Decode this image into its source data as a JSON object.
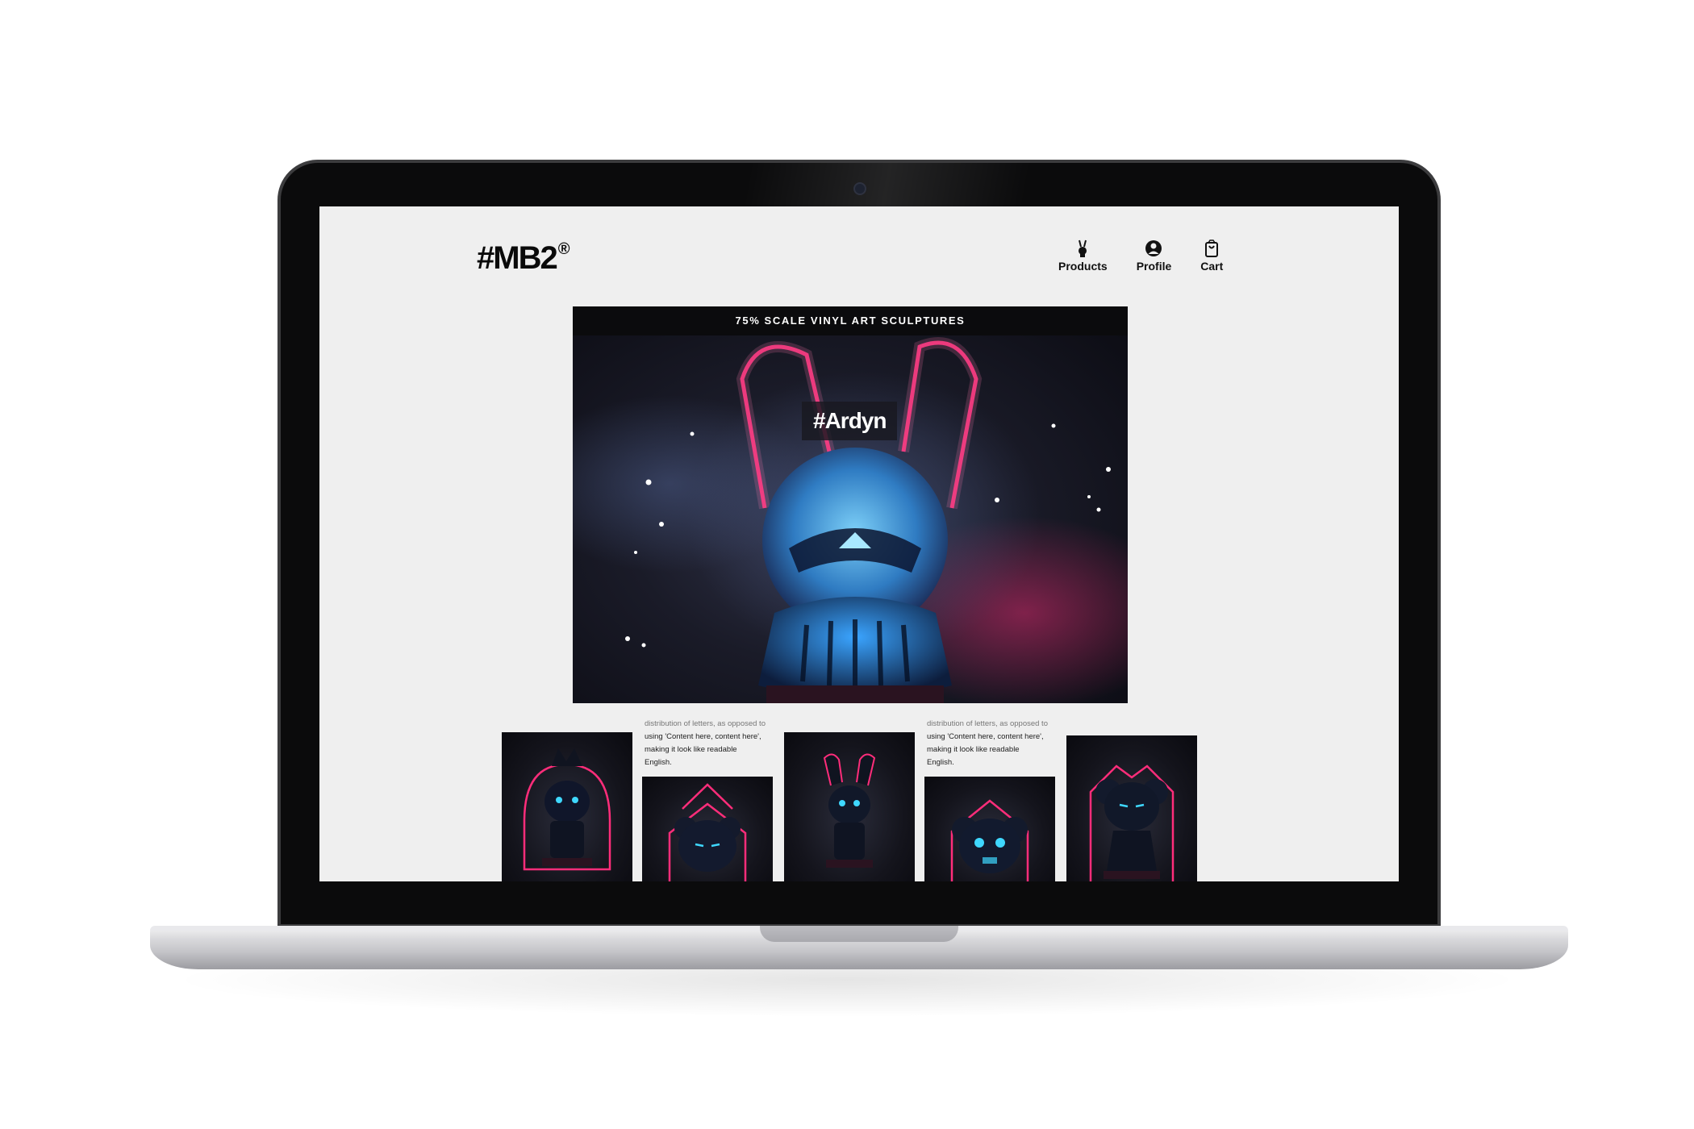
{
  "site": {
    "logo_text": "#MB2",
    "logo_mark": "®"
  },
  "nav": {
    "items": [
      {
        "label": "Products",
        "icon": "bunny-icon"
      },
      {
        "label": "Profile",
        "icon": "user-icon"
      },
      {
        "label": "Cart",
        "icon": "shopping-bag-icon"
      }
    ]
  },
  "hero": {
    "banner": "75% SCALE VINYL ART SCULPTURES",
    "tag": "#Ardyn"
  },
  "gallery": {
    "text_blocks": [
      {
        "line1": "distribution of letters, as opposed to",
        "line2": "using 'Content here, content here',",
        "line3": "making it look like readable English."
      },
      {
        "line1": "distribution of letters, as opposed to",
        "line2": "using 'Content here, content here',",
        "line3": "making it look like readable English."
      }
    ]
  },
  "colors": {
    "neon_pink": "#ff2d7a",
    "neon_cyan": "#3fd8ff",
    "page_bg": "#efefef",
    "bezel": "#0b0b0c"
  }
}
